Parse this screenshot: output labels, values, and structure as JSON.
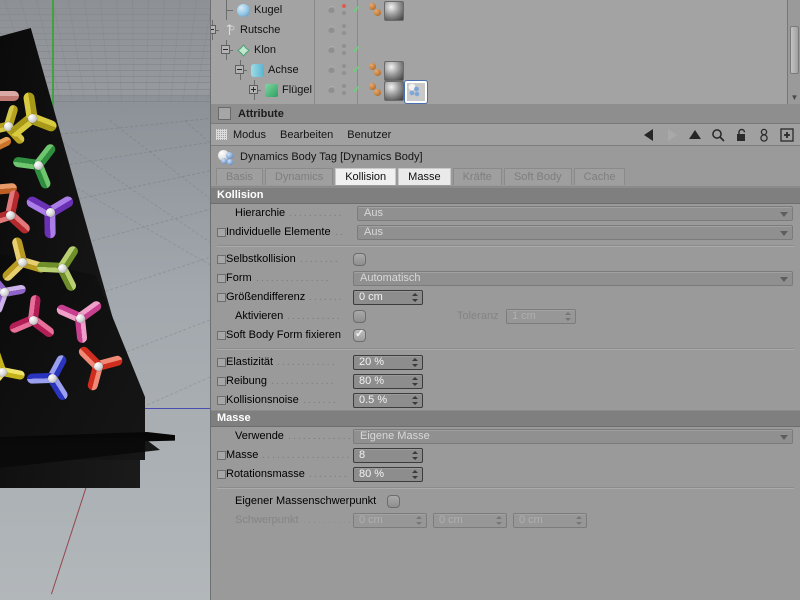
{
  "viewport": {
    "name": "perspective-viewport",
    "description": "3D perspective view with tilted dark ramp covered in colored three-blade propeller clones on a gray ground grid"
  },
  "object_manager": {
    "title": "Object Manager",
    "rows": [
      {
        "label": "Kugel",
        "icon": "sphere-object-icon",
        "depth": 1,
        "expander": "none",
        "check": true,
        "keydot": "red",
        "tags": [
          "dynamics-tag",
          "material-tag"
        ]
      },
      {
        "label": "Rutsche",
        "icon": "null-object-icon",
        "depth": 0,
        "expander": "minus",
        "check": false,
        "keydot": "gray",
        "tags": []
      },
      {
        "label": "Klon",
        "icon": "cloner-object-icon",
        "depth": 1,
        "expander": "minus",
        "check": true,
        "keydot": "gray",
        "tags": []
      },
      {
        "label": "Achse",
        "icon": "cylinder-object-icon",
        "depth": 2,
        "expander": "minus",
        "check": true,
        "keydot": "gray",
        "tags": [
          "dynamics-tag",
          "material-tag"
        ]
      },
      {
        "label": "Flügel",
        "icon": "cube-object-icon",
        "depth": 3,
        "expander": "plus",
        "check": true,
        "keydot": "gray",
        "tags": [
          "dynamics-tag",
          "material-tag",
          "dynamics-body-tag-selected"
        ]
      }
    ]
  },
  "attribute_manager": {
    "panel_title": "Attribute",
    "menu": [
      "Modus",
      "Bearbeiten",
      "Benutzer"
    ],
    "tools": [
      "back-arrow-icon",
      "forward-arrow-icon",
      "up-arrow-icon",
      "search-icon",
      "lock-icon",
      "pin-icon",
      "add-icon"
    ],
    "object_title": "Dynamics Body Tag [Dynamics Body]",
    "tabs": [
      {
        "label": "Basis",
        "active": false
      },
      {
        "label": "Dynamics",
        "active": false
      },
      {
        "label": "Kollision",
        "active": true
      },
      {
        "label": "Masse",
        "active": true
      },
      {
        "label": "Kräfte",
        "active": false
      },
      {
        "label": "Soft Body",
        "active": false
      },
      {
        "label": "Cache",
        "active": false
      }
    ],
    "sections": [
      {
        "title": "Kollision",
        "rows": [
          {
            "type": "combo",
            "label": "Hierarchie",
            "value": "Aus",
            "box": false,
            "dots": 11
          },
          {
            "type": "combo",
            "label": "Individuelle Elemente",
            "value": "Aus",
            "box": true,
            "dots": 2
          },
          {
            "type": "rule"
          },
          {
            "type": "toggle",
            "label": "Selbstkollision",
            "value": "off",
            "box": true,
            "dots": 8
          },
          {
            "type": "combo",
            "label": "Form",
            "value": "Automatisch",
            "box": true,
            "dots": 15
          },
          {
            "type": "number",
            "label": "Größendifferenz",
            "value": "0 cm",
            "box": true,
            "dots": 7
          },
          {
            "type": "toggle_with_sub",
            "label": "Aktivieren",
            "value": "off",
            "box": false,
            "dots": 11,
            "sub_label": "Toleranz",
            "sub_value": "1 cm",
            "sub_disabled": true
          },
          {
            "type": "toggle",
            "label": "Soft Body Form fixieren",
            "value": "on",
            "box": true,
            "dots": 0
          },
          {
            "type": "rule"
          },
          {
            "type": "number",
            "label": "Elastizität",
            "value": "20 %",
            "box": true,
            "dots": 12
          },
          {
            "type": "number",
            "label": "Reibung",
            "value": "80 %",
            "box": true,
            "dots": 13
          },
          {
            "type": "number",
            "label": "Kollisionsnoise",
            "value": "0.5 %",
            "box": true,
            "dots": 7
          }
        ]
      },
      {
        "title": "Masse",
        "rows": [
          {
            "type": "combo",
            "label": "Verwende",
            "value": "Eigene Masse",
            "box": false,
            "dots": 16
          },
          {
            "type": "number",
            "label": "Masse",
            "value": "8",
            "box": true,
            "dots": 18
          },
          {
            "type": "number",
            "label": "Rotationsmasse",
            "value": "80 %",
            "box": true,
            "dots": 12
          },
          {
            "type": "rule"
          },
          {
            "type": "toggle",
            "label": "Eigener Massenschwerpunkt",
            "value": "off",
            "box": false,
            "dots": 0,
            "nolead": true
          },
          {
            "type": "vector",
            "label": "Schwerpunkt",
            "values": [
              "0 cm",
              "0 cm",
              "0 cm"
            ],
            "box": false,
            "dots": 14,
            "disabled": true
          }
        ]
      }
    ]
  },
  "colors": {
    "panel_bg": "#9a9a9a",
    "group_header_bg": "#7f7f7f",
    "tab_active_bg": "#f0f0f0",
    "field_bg": "#8d8d8d",
    "check_green": "#6fd07a",
    "key_red": "#e05a4e",
    "axis_green": "#3fa33f"
  }
}
